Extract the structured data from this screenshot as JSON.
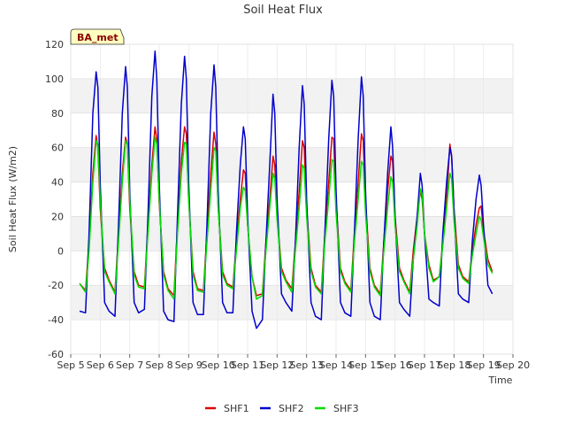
{
  "chart_data": {
    "type": "line",
    "title": "Soil Heat Flux",
    "xlabel": "Time",
    "ylabel": "Soil Heat Flux (W/m2)",
    "badge": "BA_met",
    "ylim": [
      -60,
      120
    ],
    "yticks": [
      -60,
      -40,
      -20,
      0,
      20,
      40,
      60,
      80,
      100,
      120
    ],
    "xlim": [
      5,
      20
    ],
    "xticks": [
      5,
      6,
      7,
      8,
      9,
      10,
      11,
      12,
      13,
      14,
      15,
      16,
      17,
      18,
      19,
      20
    ],
    "xtick_labels": [
      "Sep 5",
      "Sep 6",
      "Sep 7",
      "Sep 8",
      "Sep 9",
      "Sep 10",
      "Sep 11",
      "Sep 12",
      "Sep 13",
      "Sep 14",
      "Sep 15",
      "Sep 16",
      "Sep 17",
      "Sep 18",
      "Sep 19",
      "Sep 20"
    ],
    "grid": true,
    "legend_position": "bottom",
    "series": [
      {
        "name": "SHF1",
        "color": "#dd0000",
        "x": [
          5.3,
          5.5,
          5.62,
          5.75,
          5.86,
          5.92,
          6.0,
          6.15,
          6.3,
          6.5,
          6.62,
          6.75,
          6.86,
          6.92,
          7.0,
          7.15,
          7.3,
          7.5,
          7.62,
          7.75,
          7.86,
          7.92,
          8.0,
          8.15,
          8.3,
          8.5,
          8.62,
          8.75,
          8.86,
          8.92,
          9.0,
          9.15,
          9.3,
          9.5,
          9.62,
          9.75,
          9.86,
          9.92,
          10.0,
          10.15,
          10.3,
          10.5,
          10.62,
          10.75,
          10.86,
          10.92,
          11.0,
          11.15,
          11.3,
          11.5,
          11.62,
          11.75,
          11.86,
          11.92,
          12.0,
          12.15,
          12.3,
          12.5,
          12.62,
          12.75,
          12.86,
          12.92,
          13.0,
          13.15,
          13.3,
          13.5,
          13.62,
          13.75,
          13.86,
          13.92,
          14.0,
          14.15,
          14.3,
          14.5,
          14.62,
          14.75,
          14.86,
          14.92,
          15.0,
          15.15,
          15.3,
          15.5,
          15.62,
          15.75,
          15.86,
          15.92,
          16.0,
          16.15,
          16.3,
          16.5,
          16.62,
          16.75,
          16.86,
          16.92,
          17.0,
          17.15,
          17.3,
          17.5,
          17.62,
          17.75,
          17.86,
          17.92,
          18.0,
          18.15,
          18.3,
          18.5,
          18.62,
          18.75,
          18.86,
          18.92,
          19.0,
          19.15,
          19.3
        ],
        "y": [
          -19,
          -23,
          5,
          45,
          67,
          60,
          25,
          -10,
          -17,
          -24,
          10,
          45,
          66,
          62,
          25,
          -12,
          -20,
          -21,
          15,
          50,
          72,
          65,
          28,
          -12,
          -22,
          -26,
          15,
          52,
          72,
          68,
          30,
          -12,
          -22,
          -23,
          10,
          45,
          69,
          62,
          25,
          -12,
          -19,
          -21,
          5,
          30,
          47,
          45,
          15,
          -15,
          -26,
          -25,
          5,
          30,
          55,
          50,
          20,
          -10,
          -17,
          -22,
          5,
          35,
          64,
          60,
          25,
          -10,
          -20,
          -24,
          10,
          40,
          66,
          65,
          28,
          -10,
          -18,
          -23,
          10,
          40,
          68,
          64,
          28,
          -10,
          -20,
          -25,
          5,
          35,
          55,
          52,
          20,
          -10,
          -17,
          -24,
          0,
          20,
          35,
          30,
          10,
          -8,
          -17,
          -15,
          5,
          30,
          62,
          55,
          25,
          -8,
          -15,
          -18,
          0,
          15,
          25,
          26,
          12,
          -5,
          -12
        ]
      },
      {
        "name": "SHF2",
        "color": "#0000cc",
        "x": [
          5.3,
          5.5,
          5.62,
          5.75,
          5.86,
          5.92,
          6.0,
          6.15,
          6.3,
          6.5,
          6.62,
          6.75,
          6.86,
          6.92,
          7.0,
          7.15,
          7.3,
          7.5,
          7.62,
          7.75,
          7.86,
          7.92,
          8.0,
          8.15,
          8.3,
          8.5,
          8.62,
          8.75,
          8.86,
          8.92,
          9.0,
          9.15,
          9.3,
          9.5,
          9.62,
          9.75,
          9.86,
          9.92,
          10.0,
          10.15,
          10.3,
          10.5,
          10.62,
          10.75,
          10.86,
          10.92,
          11.0,
          11.15,
          11.3,
          11.5,
          11.62,
          11.75,
          11.86,
          11.92,
          12.0,
          12.15,
          12.3,
          12.5,
          12.62,
          12.75,
          12.86,
          12.92,
          13.0,
          13.15,
          13.3,
          13.5,
          13.62,
          13.75,
          13.86,
          13.92,
          14.0,
          14.15,
          14.3,
          14.5,
          14.62,
          14.75,
          14.86,
          14.92,
          15.0,
          15.15,
          15.3,
          15.5,
          15.62,
          15.75,
          15.86,
          15.92,
          16.0,
          16.15,
          16.3,
          16.5,
          16.62,
          16.75,
          16.86,
          16.92,
          17.0,
          17.15,
          17.3,
          17.5,
          17.62,
          17.75,
          17.86,
          17.92,
          18.0,
          18.15,
          18.3,
          18.5,
          18.62,
          18.75,
          18.86,
          18.92,
          19.0,
          19.15,
          19.3
        ],
        "y": [
          -35,
          -36,
          10,
          80,
          104,
          95,
          40,
          -30,
          -35,
          -38,
          15,
          80,
          107,
          95,
          35,
          -30,
          -36,
          -34,
          20,
          90,
          116,
          100,
          40,
          -35,
          -40,
          -41,
          20,
          85,
          113,
          100,
          40,
          -30,
          -37,
          -37,
          15,
          80,
          108,
          95,
          35,
          -30,
          -36,
          -36,
          10,
          50,
          72,
          65,
          20,
          -35,
          -45,
          -40,
          5,
          50,
          91,
          80,
          30,
          -25,
          -30,
          -35,
          5,
          60,
          96,
          85,
          30,
          -30,
          -38,
          -40,
          10,
          65,
          99,
          90,
          35,
          -30,
          -36,
          -38,
          10,
          65,
          101,
          90,
          35,
          -30,
          -38,
          -40,
          5,
          45,
          72,
          60,
          20,
          -30,
          -34,
          -38,
          -5,
          20,
          45,
          38,
          10,
          -28,
          -30,
          -32,
          10,
          40,
          60,
          55,
          25,
          -25,
          -28,
          -30,
          5,
          30,
          44,
          38,
          15,
          -20,
          -25
        ]
      },
      {
        "name": "SHF3",
        "color": "#00dd00",
        "x": [
          5.3,
          5.5,
          5.62,
          5.75,
          5.86,
          5.92,
          6.0,
          6.15,
          6.3,
          6.5,
          6.62,
          6.75,
          6.86,
          6.92,
          7.0,
          7.15,
          7.3,
          7.5,
          7.62,
          7.75,
          7.86,
          7.92,
          8.0,
          8.15,
          8.3,
          8.5,
          8.62,
          8.75,
          8.86,
          8.92,
          9.0,
          9.15,
          9.3,
          9.5,
          9.62,
          9.75,
          9.86,
          9.92,
          10.0,
          10.15,
          10.3,
          10.5,
          10.62,
          10.75,
          10.86,
          10.92,
          11.0,
          11.15,
          11.3,
          11.5,
          11.62,
          11.75,
          11.86,
          11.92,
          12.0,
          12.15,
          12.3,
          12.5,
          12.62,
          12.75,
          12.86,
          12.92,
          13.0,
          13.15,
          13.3,
          13.5,
          13.62,
          13.75,
          13.86,
          13.92,
          14.0,
          14.15,
          14.3,
          14.5,
          14.62,
          14.75,
          14.86,
          14.92,
          15.0,
          15.15,
          15.3,
          15.5,
          15.62,
          15.75,
          15.86,
          15.92,
          16.0,
          16.15,
          16.3,
          16.5,
          16.62,
          16.75,
          16.86,
          16.92,
          17.0,
          17.15,
          17.3,
          17.5,
          17.62,
          17.75,
          17.86,
          17.92,
          18.0,
          18.15,
          18.3,
          18.5,
          18.62,
          18.75,
          18.86,
          18.92,
          19.0,
          19.15,
          19.3
        ],
        "y": [
          -19,
          -24,
          0,
          40,
          64,
          62,
          30,
          -12,
          -18,
          -25,
          5,
          40,
          64,
          62,
          30,
          -14,
          -21,
          -22,
          10,
          45,
          66,
          62,
          30,
          -14,
          -23,
          -28,
          10,
          45,
          63,
          62,
          30,
          -14,
          -23,
          -24,
          5,
          35,
          60,
          58,
          25,
          -14,
          -20,
          -22,
          0,
          25,
          37,
          35,
          15,
          -15,
          -28,
          -26,
          0,
          25,
          45,
          42,
          18,
          -12,
          -18,
          -24,
          0,
          25,
          50,
          48,
          20,
          -12,
          -21,
          -25,
          5,
          30,
          53,
          52,
          22,
          -12,
          -19,
          -24,
          5,
          30,
          52,
          50,
          22,
          -12,
          -21,
          -26,
          0,
          25,
          43,
          40,
          15,
          -12,
          -18,
          -25,
          -5,
          15,
          36,
          33,
          10,
          -10,
          -18,
          -15,
          3,
          25,
          45,
          42,
          18,
          -10,
          -16,
          -19,
          -3,
          10,
          20,
          18,
          8,
          -8,
          -13
        ]
      }
    ]
  }
}
